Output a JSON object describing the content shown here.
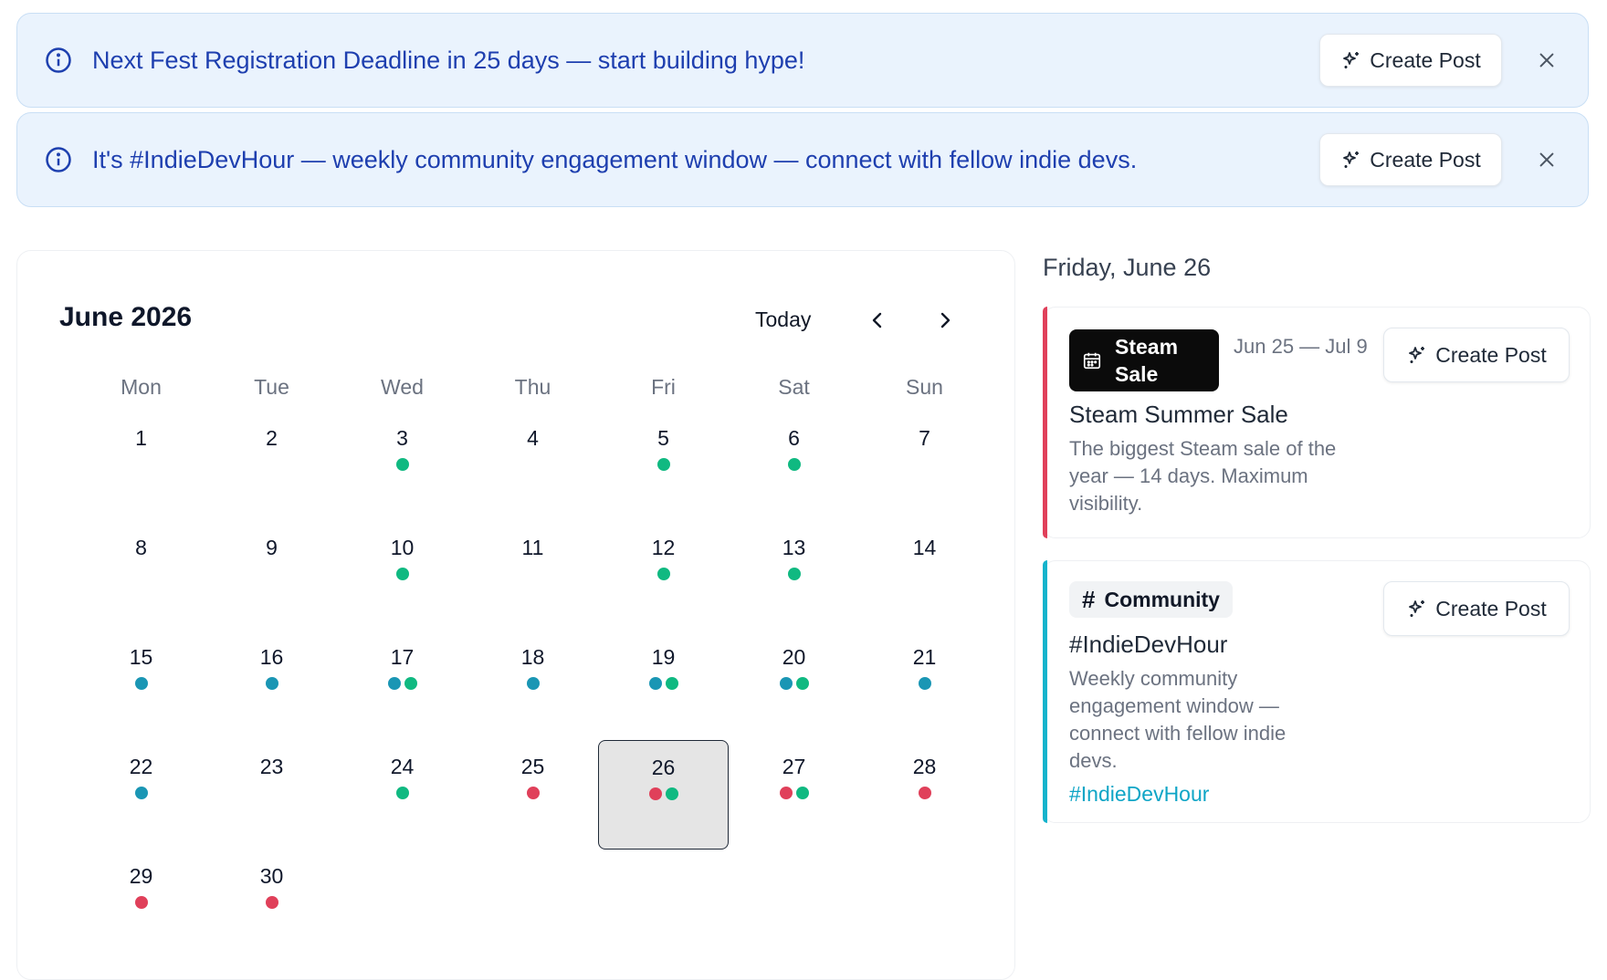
{
  "banners": [
    {
      "message": "Next Fest Registration Deadline in 25 days — start building hype!",
      "button_label": "Create Post"
    },
    {
      "message": "It's #IndieDevHour — weekly community engagement window — connect with fellow indie devs.",
      "button_label": "Create Post"
    }
  ],
  "calendar": {
    "title": "June 2026",
    "today_label": "Today",
    "weekdays": [
      "Mon",
      "Tue",
      "Wed",
      "Thu",
      "Fri",
      "Sat",
      "Sun"
    ],
    "selected_day": 26,
    "days": [
      {
        "day": "1",
        "dots": []
      },
      {
        "day": "2",
        "dots": []
      },
      {
        "day": "3",
        "dots": [
          "green"
        ]
      },
      {
        "day": "4",
        "dots": []
      },
      {
        "day": "5",
        "dots": [
          "green"
        ]
      },
      {
        "day": "6",
        "dots": [
          "green"
        ]
      },
      {
        "day": "7",
        "dots": []
      },
      {
        "day": "8",
        "dots": []
      },
      {
        "day": "9",
        "dots": []
      },
      {
        "day": "10",
        "dots": [
          "green"
        ]
      },
      {
        "day": "11",
        "dots": []
      },
      {
        "day": "12",
        "dots": [
          "green"
        ]
      },
      {
        "day": "13",
        "dots": [
          "green"
        ]
      },
      {
        "day": "14",
        "dots": []
      },
      {
        "day": "15",
        "dots": [
          "teal"
        ]
      },
      {
        "day": "16",
        "dots": [
          "teal"
        ]
      },
      {
        "day": "17",
        "dots": [
          "teal",
          "green"
        ]
      },
      {
        "day": "18",
        "dots": [
          "teal"
        ]
      },
      {
        "day": "19",
        "dots": [
          "teal",
          "green"
        ]
      },
      {
        "day": "20",
        "dots": [
          "teal",
          "green"
        ]
      },
      {
        "day": "21",
        "dots": [
          "teal"
        ]
      },
      {
        "day": "22",
        "dots": [
          "teal"
        ]
      },
      {
        "day": "23",
        "dots": []
      },
      {
        "day": "24",
        "dots": [
          "green"
        ]
      },
      {
        "day": "25",
        "dots": [
          "red"
        ]
      },
      {
        "day": "26",
        "dots": [
          "red",
          "green"
        ]
      },
      {
        "day": "27",
        "dots": [
          "red",
          "green"
        ]
      },
      {
        "day": "28",
        "dots": [
          "red"
        ]
      },
      {
        "day": "29",
        "dots": [
          "red"
        ]
      },
      {
        "day": "30",
        "dots": [
          "red"
        ]
      }
    ]
  },
  "dot_colors": {
    "green": "#10b981",
    "teal": "#1a96b4",
    "red": "#e0405a"
  },
  "detail": {
    "date_heading": "Friday, June 26",
    "events": [
      {
        "badge": "Steam Sale",
        "badge_icon": "calendar-icon",
        "date_range": "Jun 25 — Jul 9",
        "title": "Steam Summer Sale",
        "description": "The biggest Steam sale of the year — 14 days. Maximum visibility.",
        "button_label": "Create Post",
        "accent_color": "#e0405a"
      },
      {
        "badge": "Community",
        "badge_icon": "hash-icon",
        "title": "#IndieDevHour",
        "description": "Weekly community engagement window — connect with fellow indie devs.",
        "hashtag": "#IndieDevHour",
        "button_label": "Create Post",
        "accent_color": "#14b3cc"
      }
    ]
  }
}
